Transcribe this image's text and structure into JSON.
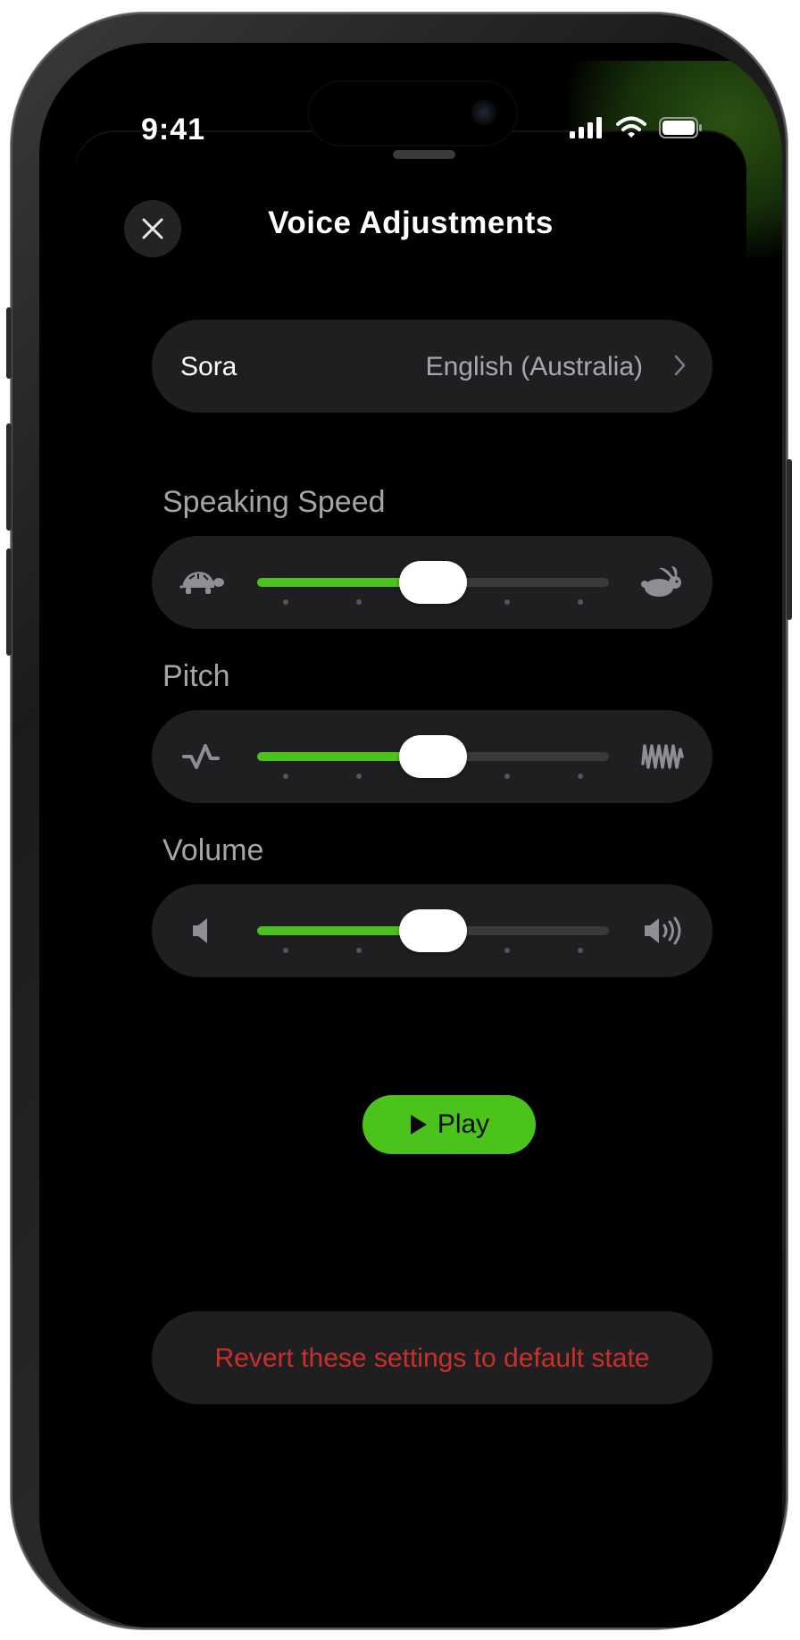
{
  "status_bar": {
    "time": "9:41"
  },
  "sheet": {
    "title": "Voice Adjustments",
    "close_icon": "close-icon"
  },
  "voice": {
    "name": "Sora",
    "language": "English (Australia)"
  },
  "sliders": [
    {
      "label": "Speaking Speed",
      "left_icon": "turtle-icon",
      "right_icon": "rabbit-icon",
      "value_fraction": 0.5,
      "steps": 5
    },
    {
      "label": "Pitch",
      "left_icon": "low-wave-icon",
      "right_icon": "high-wave-icon",
      "value_fraction": 0.5,
      "steps": 5
    },
    {
      "label": "Volume",
      "left_icon": "speaker-low-icon",
      "right_icon": "speaker-high-icon",
      "value_fraction": 0.5,
      "steps": 5
    }
  ],
  "play": {
    "label": "Play"
  },
  "revert": {
    "label": "Revert these settings to default state"
  },
  "colors": {
    "accent": "#4cc31c",
    "danger": "#c9302c",
    "card": "#1f1f21",
    "background": "#000000"
  }
}
